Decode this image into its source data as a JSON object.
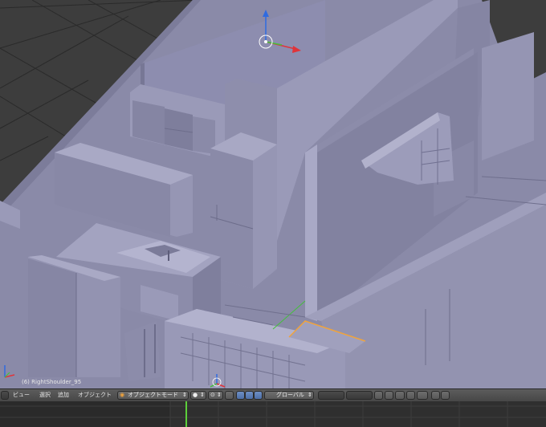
{
  "viewport": {
    "object_label": "(6) RightShoulder_95",
    "background_color": "#3d3d3d",
    "model_color": "#8f8fae"
  },
  "header": {
    "menu": {
      "view": "ビュー",
      "select": "選択",
      "add": "追加",
      "object": "オブジェクト"
    },
    "mode_label": "オブジェクトモード",
    "orientation_label": "グローバル",
    "icons": [
      "editor-type-icon",
      "mode-icon",
      "shading-sphere-icon",
      "pivot-icon",
      "manipulator-icon",
      "translate-icon",
      "rotate-icon",
      "scale-icon",
      "layer-buttons",
      "lock-icon",
      "snap-icon",
      "render-icon",
      "camera-icon"
    ]
  },
  "timeline": {
    "current_frame_color": "#5ccf3a"
  },
  "accent": {
    "axis_x": "#e0343a",
    "axis_y": "#44c03c",
    "axis_z": "#2f6be0",
    "selection": "#f0a33c"
  }
}
